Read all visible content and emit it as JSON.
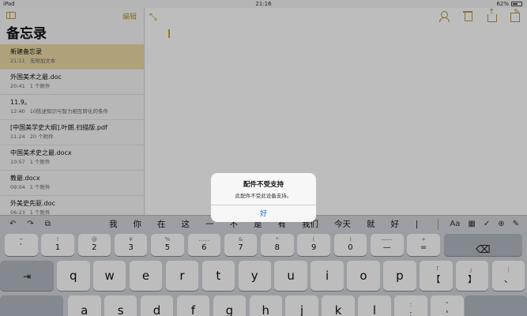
{
  "status": {
    "device": "iPad",
    "time": "21:16",
    "battery": "62%",
    "battery_level": 0.62
  },
  "sidebar": {
    "edit_label": "编辑",
    "title": "备忘录",
    "notes": [
      {
        "title": "新建备忘录",
        "time": "21:11",
        "preview": "无附加文本",
        "selected": true
      },
      {
        "title": "外国美术之最.doc",
        "time": "20:41",
        "preview": "1 个附件"
      },
      {
        "title": "11.9。",
        "time": "12:40",
        "preview": "10陈述知识与智力相互转化的条件"
      },
      {
        "title": "[中国美学史大纲].叶朗.扫描版.pdf",
        "time": "11:24",
        "preview": "20 个附件"
      },
      {
        "title": "中国美术史之最.docx",
        "time": "10:57",
        "preview": "1 个附件"
      },
      {
        "title": "教最.docx",
        "time": "09:04",
        "preview": "1 个附件"
      },
      {
        "title": "外美史先驱.doc",
        "time": "06:23",
        "preview": "1 个附件"
      }
    ]
  },
  "main": {
    "expand_icon": "⤡"
  },
  "keyboard": {
    "toolbar_left": [
      "↶",
      "↷",
      "⧉"
    ],
    "candidates": [
      "我",
      "你",
      "在",
      "这",
      "一",
      "不",
      "是",
      "有",
      "我们",
      "今天",
      "就",
      "好",
      "∣"
    ],
    "toolbar_right": [
      "Aa",
      "▦",
      "✓",
      "⊕",
      "✎"
    ],
    "number_row": [
      {
        "top": "~",
        "bot": "`"
      },
      {
        "top": "!",
        "bot": "1"
      },
      {
        "top": "@",
        "bot": "2"
      },
      {
        "top": "¥",
        "bot": "3"
      },
      {
        "top": "%",
        "bot": "5"
      },
      {
        "top": "……",
        "bot": "6"
      },
      {
        "top": "&",
        "bot": "7"
      },
      {
        "top": "*",
        "bot": "8"
      },
      {
        "top": "(",
        "bot": "9"
      },
      {
        "top": ")",
        "bot": "0"
      },
      {
        "top": "——",
        "bot": "—"
      },
      {
        "top": "+",
        "bot": "="
      }
    ],
    "delete_icon": "⌫",
    "tab_label": "⇥",
    "row_q": [
      "q",
      "w",
      "e",
      "r",
      "t",
      "y",
      "u",
      "i",
      "o",
      "p"
    ],
    "row_q_extra": [
      {
        "top": "「",
        "bot": "【"
      },
      {
        "top": "」",
        "bot": "】"
      },
      {
        "top": "｜",
        "bot": "、"
      }
    ],
    "row_a": [
      "a",
      "s",
      "d",
      "f",
      "g",
      "h",
      "j",
      "k",
      "l"
    ],
    "row_a_extra": [
      {
        "top": ":",
        "bot": ";"
      },
      {
        "top": "\"",
        "bot": "'"
      }
    ]
  },
  "alert": {
    "title": "配件不受支持",
    "message": "此配件不受此设备支持。",
    "button": "好"
  }
}
